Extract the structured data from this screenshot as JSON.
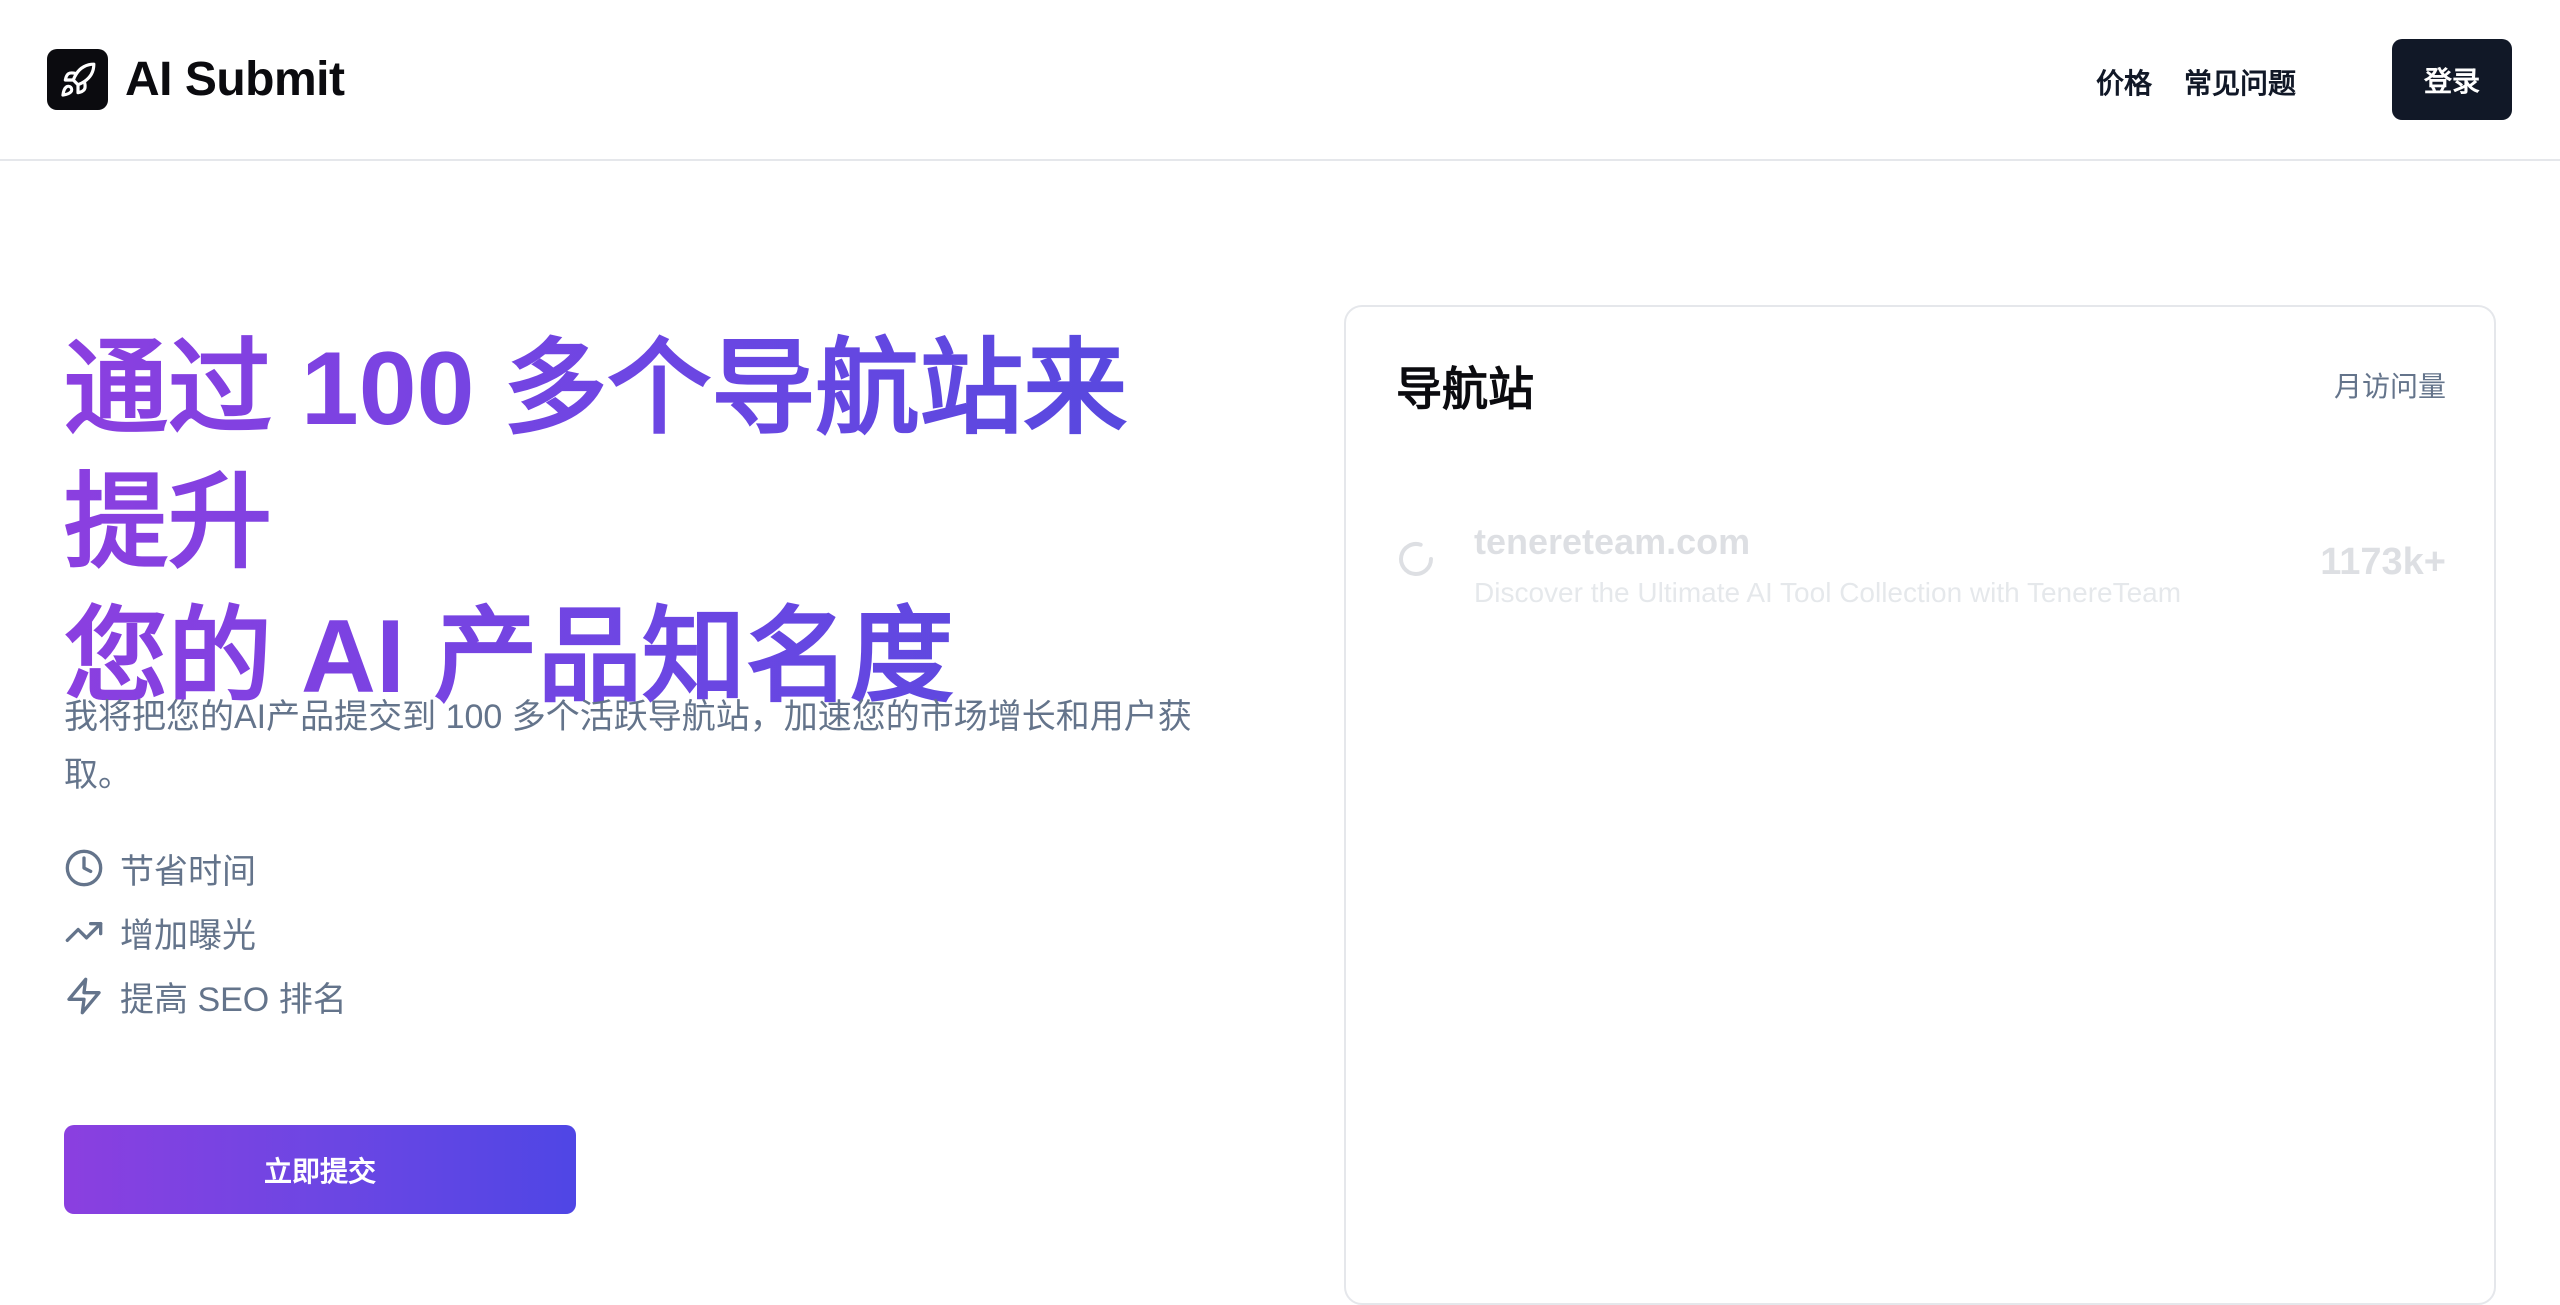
{
  "header": {
    "brand_name": "AI Submit",
    "nav": [
      {
        "label": "价格"
      },
      {
        "label": "常见问题"
      }
    ],
    "login_label": "登录"
  },
  "hero": {
    "title_line1": "通过 100 多个导航站来提升",
    "title_line2": "您的 AI 产品知名度",
    "description": "我将把您的AI产品提交到 100 多个活跃导航站，加速您的市场增长和用户获取。",
    "features": [
      {
        "icon": "clock-icon",
        "label": "节省时间"
      },
      {
        "icon": "trending-up-icon",
        "label": "增加曝光"
      },
      {
        "icon": "lightning-icon",
        "label": "提高 SEO 排名"
      }
    ],
    "cta_label": "立即提交"
  },
  "panel": {
    "title": "导航站",
    "column_label": "月访问量",
    "sites": [
      {
        "name": "tenereteam.com",
        "description": "Discover the Ultimate AI Tool Collection with TenereTeam",
        "visits": "1173k+"
      }
    ]
  },
  "colors": {
    "gradient_start": "#8b3fe0",
    "gradient_end": "#4f46e5",
    "dark": "#111827",
    "muted_text": "#64748b"
  }
}
